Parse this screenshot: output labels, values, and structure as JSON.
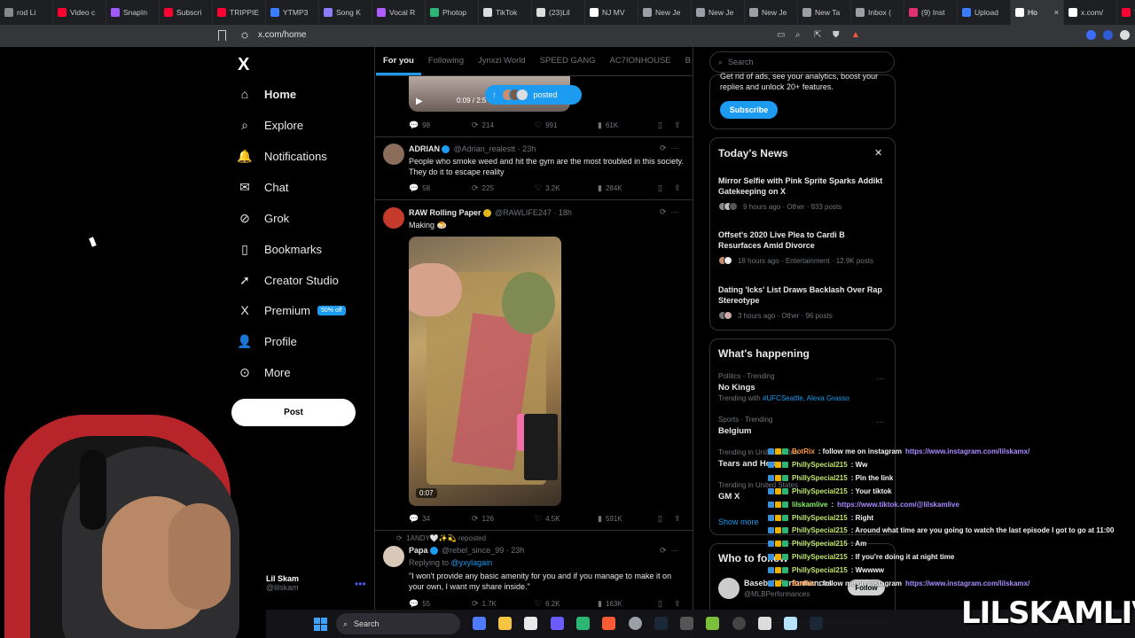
{
  "browser": {
    "tabs": [
      {
        "label": "rod Li",
        "color": "#888888"
      },
      {
        "label": "Video c",
        "color": "#ff0033"
      },
      {
        "label": "SnapIn",
        "color": "#a259ff"
      },
      {
        "label": "Subscri",
        "color": "#ff0033"
      },
      {
        "label": "TRIPPIE",
        "color": "#ff0033"
      },
      {
        "label": "YTMP3",
        "color": "#3a7bff"
      },
      {
        "label": "Song K",
        "color": "#8b7dff"
      },
      {
        "label": "Vocal R",
        "color": "#b05cff"
      },
      {
        "label": "Photop",
        "color": "#2bb673"
      },
      {
        "label": "TikTok",
        "color": "#dddddd"
      },
      {
        "label": "(23)Lil",
        "color": "#dddddd"
      },
      {
        "label": "NJ MV",
        "color": "#ffffff"
      },
      {
        "label": "New Je",
        "color": "#9aa0a6"
      },
      {
        "label": "New Je",
        "color": "#9aa0a6"
      },
      {
        "label": "New Je",
        "color": "#9aa0a6"
      },
      {
        "label": "New Ta",
        "color": "#9aa0a6"
      },
      {
        "label": "Inbox (",
        "color": "#9aa0a6"
      },
      {
        "label": "(9) Inst",
        "color": "#e1306c"
      },
      {
        "label": "Upload",
        "color": "#3a7bff"
      },
      {
        "label": "Ho",
        "color": "#ffffff",
        "active": true
      },
      {
        "label": "x.com/",
        "color": "#ffffff"
      },
      {
        "label": "YNW",
        "color": "#ff0033"
      }
    ],
    "url": "x.com/home",
    "close": "×"
  },
  "nav": {
    "logo": "X",
    "items": [
      {
        "label": "Home",
        "icon": "home-icon",
        "glyph": "⌂"
      },
      {
        "label": "Explore",
        "icon": "search-icon",
        "glyph": "⌕"
      },
      {
        "label": "Notifications",
        "icon": "bell-icon",
        "glyph": "🔔"
      },
      {
        "label": "Chat",
        "icon": "mail-icon",
        "glyph": "✉"
      },
      {
        "label": "Grok",
        "icon": "grok-icon",
        "glyph": "⊘"
      },
      {
        "label": "Bookmarks",
        "icon": "bookmark-icon",
        "glyph": "▯"
      },
      {
        "label": "Creator Studio",
        "icon": "rocket-icon",
        "glyph": "➚"
      },
      {
        "label": "Premium",
        "icon": "x-icon",
        "glyph": "X",
        "badge": "50% off"
      },
      {
        "label": "Profile",
        "icon": "person-icon",
        "glyph": "👤"
      },
      {
        "label": "More",
        "icon": "more-icon",
        "glyph": "⊙"
      }
    ],
    "post": "Post",
    "account": {
      "name": "Lil Skam",
      "handle": "@lilskam"
    }
  },
  "feed": {
    "tabs": [
      "For you",
      "Following",
      "Jynxzi World",
      "SPEED GANG",
      "AC7IONHOUSE",
      "B"
    ],
    "posted_pill": "posted",
    "video1": {
      "time": "0:09 / 2:5"
    },
    "stats1": [
      "98",
      "214",
      "991",
      "61K"
    ],
    "tweets": [
      {
        "name": "ADRIAN",
        "handle": "@Adrian_realestt · 23h",
        "text": "People who smoke weed and hit the gym are the most troubled in this society. They do it to escape reality",
        "stats": [
          "58",
          "225",
          "3.2K",
          "284K"
        ]
      },
      {
        "name": "RAW Rolling Paper",
        "handle": "@RAWLIFE247 · 18h",
        "text": "Making 🍮",
        "video_time": "0:07",
        "stats": [
          "34",
          "126",
          "4.5K",
          "591K"
        ]
      },
      {
        "repost": "1ANDY🤍✨💫 reposted",
        "name": "Papa",
        "handle": "@rebel_since_99 · 23h",
        "replying_prefix": "Replying to ",
        "replying_to": "@yxylagain",
        "text": "\"I won't provide any basic amenity for you and if you manage to make it on your own, I want my share inside.\"",
        "stats": [
          "55",
          "1.7K",
          "6.2K",
          "163K"
        ]
      }
    ]
  },
  "right": {
    "search_placeholder": "Search",
    "premium_text": "Get rid of ads, see your analytics, boost your replies and unlock 20+ features.",
    "subscribe": "Subscribe",
    "todays_news": "Today's News",
    "news": [
      {
        "title": "Mirror Selfie with Pink Sprite Sparks Addikt Gatekeeping on X",
        "meta": "9 hours ago · Other · 933 posts"
      },
      {
        "title": "Offset's 2020 Live Plea to Cardi B Resurfaces Amid Divorce",
        "meta": "18 hours ago · Entertainment · 12.9K posts"
      },
      {
        "title": "Dating 'Icks' List Draws Backlash Over Rap Stereotype",
        "meta": "3 hours ago · Other · 96 posts"
      }
    ],
    "whats_happening": "What's happening",
    "trends": [
      {
        "context": "Politics · Trending",
        "name": "No Kings",
        "sub_prefix": "Trending with ",
        "sub_links": "#UFCSeattle, Alexa Grasso"
      },
      {
        "context": "Sports · Trending",
        "name": "Belgium"
      },
      {
        "context": "Trending in United States",
        "name": "Tears and Hope"
      },
      {
        "context": "Trending in United States",
        "name": "GM X"
      }
    ],
    "show_more": "Show more",
    "who_to_follow": "Who to follow",
    "suggest": {
      "name": "Baseball Performances",
      "handle": "@MLBPerformances",
      "follow": "Follow"
    }
  },
  "chat": [
    {
      "user": "BotRix",
      "msg": ": follow me on instagram ",
      "link": "https://www.instagram.com/lilskamx/"
    },
    {
      "user": "PhillySpecial215",
      "msg": ": Ww"
    },
    {
      "user": "PhillySpecial215",
      "msg": ": Pin the link"
    },
    {
      "user": "PhillySpecial215",
      "msg": ": Your tiktok"
    },
    {
      "user": "lilskamlive",
      "msg": ": ",
      "link": "https://www.tiktok.com/@lilskamlive"
    },
    {
      "user": "PhillySpecial215",
      "msg": ": Right"
    },
    {
      "user": "PhillySpecial215",
      "msg": ": Around what time are you going to watch the last episode I got to go at 11:00"
    },
    {
      "user": "PhillySpecial215",
      "msg": ": Am"
    },
    {
      "user": "PhillySpecial215",
      "msg": ": If you're doing it at night time"
    },
    {
      "user": "PhillySpecial215",
      "msg": ": Wwwww"
    },
    {
      "user": "BotRix",
      "msg": ": follow me on instagram ",
      "link": "https://www.instagram.com/lilskamx/"
    }
  ],
  "taskbar": {
    "search": "Search"
  },
  "brand": "LILSKAMLIVE"
}
